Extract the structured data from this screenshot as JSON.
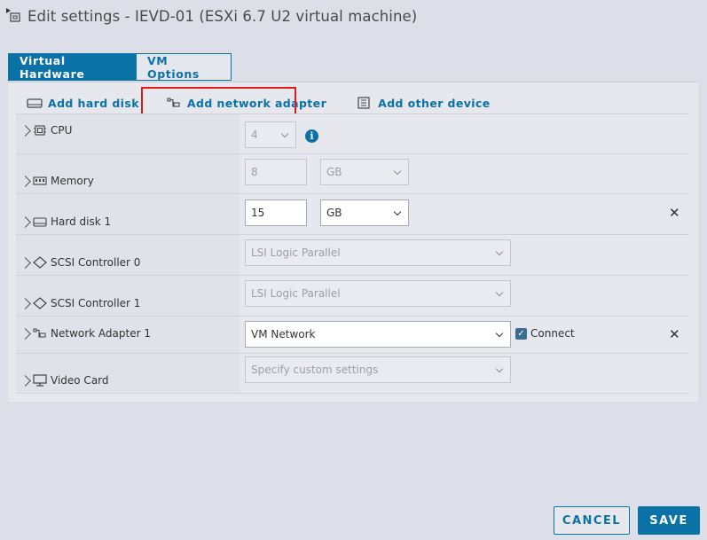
{
  "dialog": {
    "title": "Edit settings - IEVD-01 (ESXi 6.7 U2 virtual machine)"
  },
  "tabs": [
    {
      "label": "Virtual Hardware",
      "active": true
    },
    {
      "label": "VM Options",
      "active": false
    }
  ],
  "toolbar": {
    "add_hard_disk": "Add hard disk",
    "add_network_adapter": "Add network adapter",
    "add_other_device": "Add other device"
  },
  "hardware": {
    "cpu": {
      "label": "CPU",
      "value": "4"
    },
    "memory": {
      "label": "Memory",
      "value": "8",
      "unit": "GB"
    },
    "hard_disk_1": {
      "label": "Hard disk 1",
      "value": "15",
      "unit": "GB"
    },
    "scsi_0": {
      "label": "SCSI Controller 0",
      "value": "LSI Logic Parallel"
    },
    "scsi_1": {
      "label": "SCSI Controller 1",
      "value": "LSI Logic Parallel"
    },
    "network_adapter_1": {
      "label": "Network Adapter 1",
      "value": "VM Network",
      "connect_label": "Connect",
      "connected": true
    },
    "video_card": {
      "label": "Video Card",
      "value": "Specify custom settings"
    }
  },
  "footer": {
    "cancel": "CANCEL",
    "save": "SAVE"
  },
  "colors": {
    "accent": "#0b72a8",
    "highlight": "#e21a1a"
  }
}
